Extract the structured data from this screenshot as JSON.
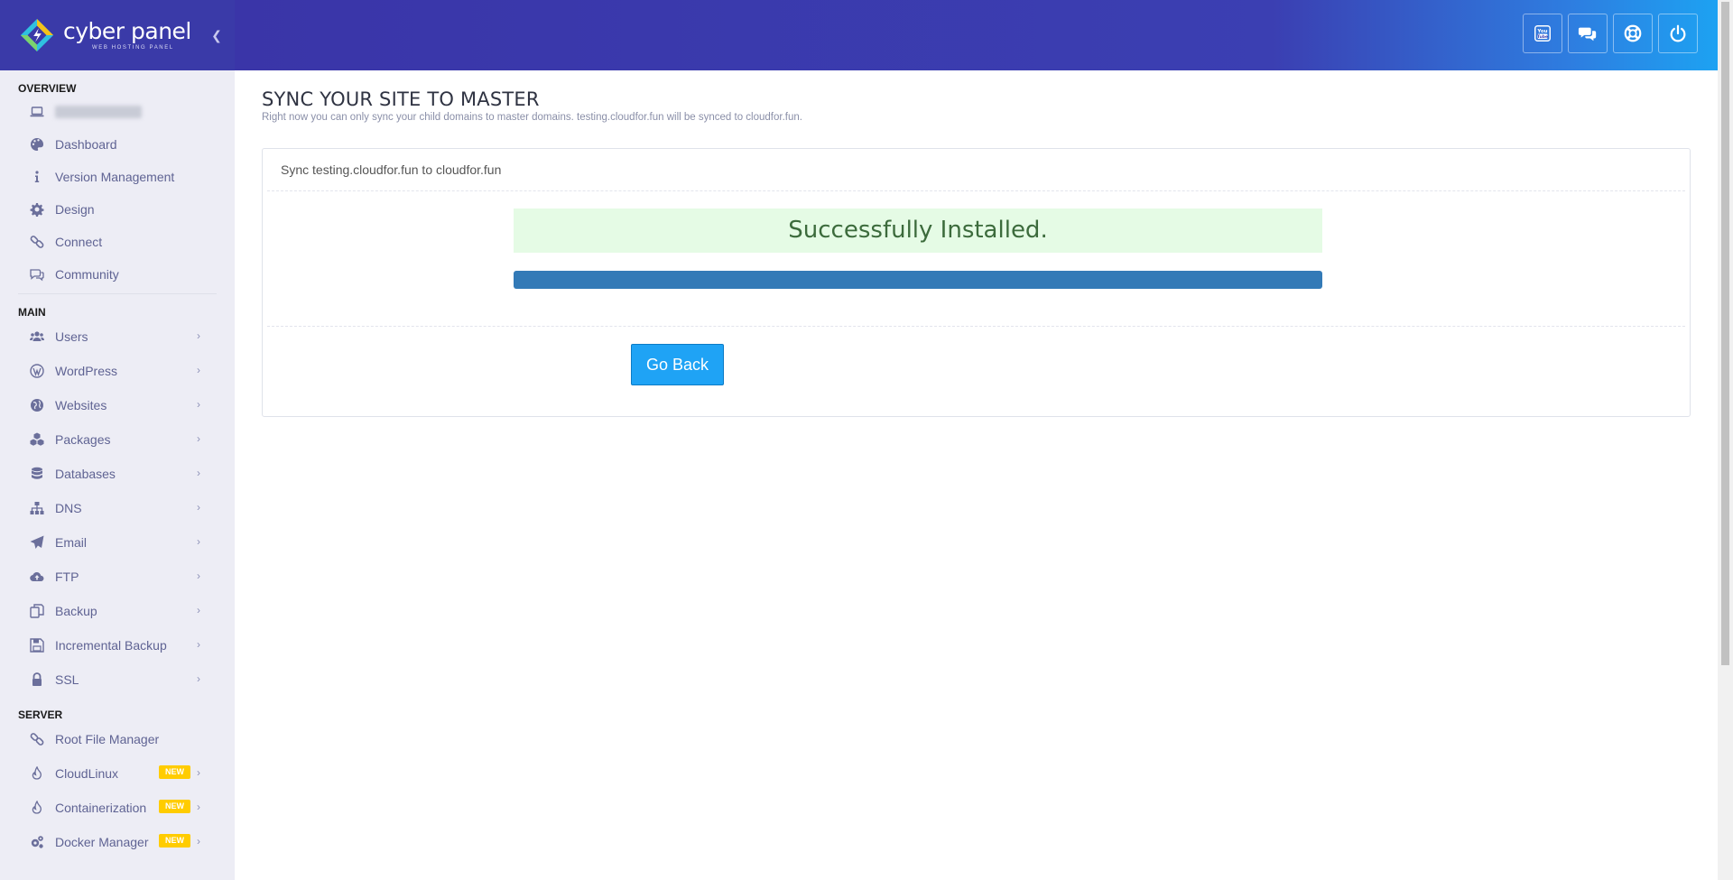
{
  "brand": {
    "name": "cyber panel",
    "tagline": "WEB HOSTING PANEL"
  },
  "header": {
    "collapse_icon": "chevron-left-icon",
    "actions": [
      {
        "name": "youtube",
        "icon": "youtube-icon"
      },
      {
        "name": "chat",
        "icon": "chat-bubbles-icon"
      },
      {
        "name": "support",
        "icon": "life-ring-icon"
      },
      {
        "name": "logout",
        "icon": "power-icon"
      }
    ]
  },
  "sidebar": {
    "overview_title": "OVERVIEW",
    "main_title": "MAIN",
    "server_title": "SERVER",
    "overview": [
      {
        "label": "Dashboard",
        "icon": "palette-icon"
      },
      {
        "label": "Version Management",
        "icon": "info-icon"
      },
      {
        "label": "Design",
        "icon": "gear-icon"
      },
      {
        "label": "Connect",
        "icon": "link-icon"
      },
      {
        "label": "Community",
        "icon": "comments-icon"
      }
    ],
    "main": [
      {
        "label": "Users",
        "icon": "users-icon"
      },
      {
        "label": "WordPress",
        "icon": "wordpress-icon"
      },
      {
        "label": "Websites",
        "icon": "globe-icon"
      },
      {
        "label": "Packages",
        "icon": "cubes-icon"
      },
      {
        "label": "Databases",
        "icon": "database-icon"
      },
      {
        "label": "DNS",
        "icon": "sitemap-icon"
      },
      {
        "label": "Email",
        "icon": "paper-plane-icon"
      },
      {
        "label": "FTP",
        "icon": "cloud-upload-icon"
      },
      {
        "label": "Backup",
        "icon": "copy-icon"
      },
      {
        "label": "Incremental Backup",
        "icon": "save-icon"
      },
      {
        "label": "SSL",
        "icon": "lock-icon"
      }
    ],
    "server": [
      {
        "label": "Root File Manager",
        "icon": "link-icon"
      },
      {
        "label": "CloudLinux",
        "icon": "fire-icon",
        "badge": "NEW"
      },
      {
        "label": "Containerization",
        "icon": "fire-icon",
        "badge": "NEW"
      },
      {
        "label": "Docker Manager",
        "icon": "gears-icon",
        "badge": "NEW"
      }
    ]
  },
  "main": {
    "title": "SYNC YOUR SITE TO MASTER",
    "subtitle": "Right now you can only sync your child domains to master domains. testing.cloudfor.fun will be synced to cloudfor.fun.",
    "panel_title": "Sync testing.cloudfor.fun to cloudfor.fun",
    "status_message": "Successfully Installed.",
    "progress_percent": 100,
    "go_back_label": "Go Back"
  },
  "colors": {
    "header_left": "#3a35a8",
    "header_right": "#1da2f2",
    "sidebar_bg": "#ededf5",
    "success_bg": "#e5fbe5",
    "progress_fill": "#337ab7",
    "button_bg": "#1fa3f5",
    "badge_bg": "#ffcc00"
  }
}
